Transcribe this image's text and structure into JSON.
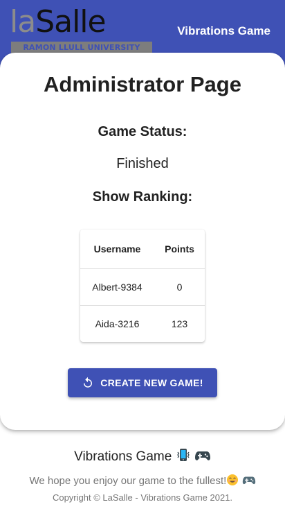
{
  "header": {
    "logo": {
      "la": "la",
      "salle": "Salle",
      "tagline": "RAMON LLULL UNIVERSITY"
    },
    "app_title": "Vibrations Game"
  },
  "admin": {
    "title": "Administrator Page",
    "status_label": "Game Status:",
    "status_value": "Finished",
    "ranking_label": "Show Ranking:",
    "ranking": {
      "columns": [
        "Username",
        "Points"
      ],
      "rows": [
        {
          "username": "Albert-9384",
          "points": "0"
        },
        {
          "username": "Aida-3216",
          "points": "123"
        }
      ]
    },
    "create_button": {
      "label": "CREATE NEW GAME!",
      "icon": "restart-icon"
    }
  },
  "footer": {
    "title": "Vibrations Game",
    "title_icons": [
      "vibrating-phone-icon",
      "gamepad-icon"
    ],
    "tagline": "We hope you enjoy our game to the fullest!",
    "tagline_icons": [
      "smiley-icon",
      "gamepad-icon"
    ],
    "copyright": "Copyright © LaSalle - Vibrations Game 2021."
  },
  "colors": {
    "primary": "#3f51b5",
    "text": "#212121",
    "muted_text": "#757575",
    "logo_gray": "#8c8c8c"
  }
}
